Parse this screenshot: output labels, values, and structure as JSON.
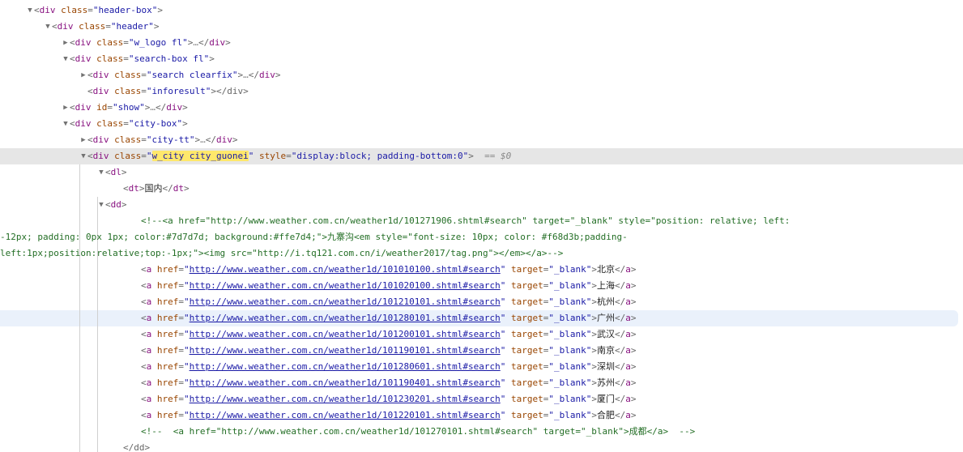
{
  "panel": {
    "name": "elements-dom-tree",
    "selected_marker": "== $0",
    "highlight_text": "w_city city_guonei",
    "ellipsis": "…"
  },
  "colors": {
    "tag": "#881280",
    "attribute_name": "#994500",
    "attribute_value": "#1a1aa6",
    "comment": "#236e25",
    "selected_row_bg": "#e6e6e6",
    "hovered_row_bg": "#eaf1fb",
    "search_highlight_bg": "#ffe86b"
  },
  "rows": [
    {
      "id": "r0",
      "indent": 0,
      "twisty": "open",
      "tag": "div",
      "attr": "class",
      "value": "header-box",
      "tail": ">"
    },
    {
      "id": "r1",
      "indent": 1,
      "twisty": "open",
      "tag": "div",
      "attr": "class",
      "value": "header",
      "tail": ">"
    },
    {
      "id": "r2",
      "indent": 2,
      "twisty": "closed",
      "tag": "div",
      "attr": "class",
      "value": "w_logo fl",
      "tail": ">…</div>"
    },
    {
      "id": "r3",
      "indent": 2,
      "twisty": "open",
      "tag": "div",
      "attr": "class",
      "value": "search-box fl",
      "tail": ">"
    },
    {
      "id": "r4",
      "indent": 3,
      "twisty": "closed",
      "tag": "div",
      "attr": "class",
      "value": "search clearfix",
      "tail": ">…</div>"
    },
    {
      "id": "r5",
      "indent": 3,
      "twisty": "none",
      "tag": "div",
      "attr": "class",
      "value": "inforesult",
      "tail": "></div>"
    },
    {
      "id": "r6",
      "indent": 2,
      "twisty": "closed",
      "tag": "div",
      "attr": "id",
      "value": "show",
      "tail": ">…</div>"
    },
    {
      "id": "r7",
      "indent": 2,
      "twisty": "open",
      "tag": "div",
      "attr": "class",
      "value": "city-box",
      "tail": ">"
    },
    {
      "id": "r8",
      "indent": 3,
      "twisty": "closed",
      "tag": "div",
      "attr": "class",
      "value": "city-tt",
      "tail": ">…</div>"
    }
  ],
  "selected_row": {
    "indent": 3,
    "tag": "div",
    "attr_class": "class",
    "class_value": "w_city city_guonei",
    "attr_style": "style",
    "style_value": "display:block; padding-bottom:0",
    "tail": ">",
    "marker": "== $0"
  },
  "dl_row": {
    "indent": 4,
    "tag": "dl",
    "tail": ">"
  },
  "dt_row": {
    "indent": 5,
    "open_tag": "dt",
    "text": "国内",
    "close_tag": "dt"
  },
  "dd_row": {
    "indent": 4,
    "tag": "dd",
    "tail": ">"
  },
  "comment_block": {
    "indent": 6,
    "line1": "<!--<a href=\"http://www.weather.com.cn/weather1d/101271906.shtml#search\" target=\"_blank\" style=\"position: relative; left:",
    "line2": "-12px; padding: 0px 1px; color:#7d7d7d; background:#ffe7d4;\">九寨沟<em style=\"font-size: 10px; color: #f68d3b;padding-",
    "line3": "left:1px;position:relative;top:-1px;\"><img src=\"http://i.tq121.com.cn/i/weather2017/tag.png\"></em></a>-->"
  },
  "links": [
    {
      "url": "http://www.weather.com.cn/weather1d/101010100.shtml#search",
      "target": "_blank",
      "city": "北京",
      "hovered": false
    },
    {
      "url": "http://www.weather.com.cn/weather1d/101020100.shtml#search",
      "target": "_blank",
      "city": "上海",
      "hovered": false
    },
    {
      "url": "http://www.weather.com.cn/weather1d/101210101.shtml#search",
      "target": "_blank",
      "city": "杭州",
      "hovered": false
    },
    {
      "url": "http://www.weather.com.cn/weather1d/101280101.shtml#search",
      "target": "_blank",
      "city": "广州",
      "hovered": true
    },
    {
      "url": "http://www.weather.com.cn/weather1d/101200101.shtml#search",
      "target": "_blank",
      "city": "武汉",
      "hovered": false
    },
    {
      "url": "http://www.weather.com.cn/weather1d/101190101.shtml#search",
      "target": "_blank",
      "city": "南京",
      "hovered": false
    },
    {
      "url": "http://www.weather.com.cn/weather1d/101280601.shtml#search",
      "target": "_blank",
      "city": "深圳",
      "hovered": false
    },
    {
      "url": "http://www.weather.com.cn/weather1d/101190401.shtml#search",
      "target": "_blank",
      "city": "苏州",
      "hovered": false
    },
    {
      "url": "http://www.weather.com.cn/weather1d/101230201.shtml#search",
      "target": "_blank",
      "city": "厦门",
      "hovered": false
    },
    {
      "url": "http://www.weather.com.cn/weather1d/101220101.shtml#search",
      "target": "_blank",
      "city": "合肥",
      "hovered": false
    }
  ],
  "trailing_comment": {
    "indent": 6,
    "text": "<!--  <a href=\"http://www.weather.com.cn/weather1d/101270101.shtml#search\" target=\"_blank\">成都</a>  -->"
  },
  "closing_dd": {
    "indent": 5,
    "text": "</dd>"
  }
}
